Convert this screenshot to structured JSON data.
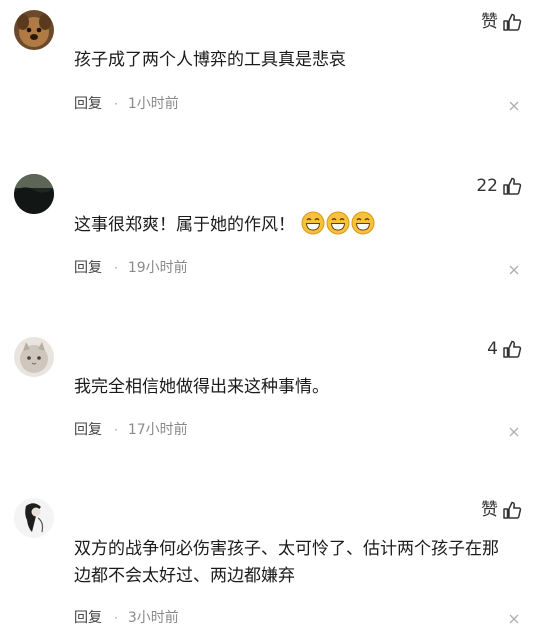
{
  "comments": [
    {
      "like_label": "赞",
      "text": "孩子成了两个人博弈的工具真是悲哀",
      "reply_label": "回复",
      "dot": "·",
      "time": "1小时前",
      "avatar_icon": "dog-avatar"
    },
    {
      "like_label": "22",
      "text": "这事很郑爽！属于她的作风！",
      "emojis": [
        "grin-emoji",
        "grin-emoji",
        "grin-emoji"
      ],
      "reply_label": "回复",
      "dot": "·",
      "time": "19小时前",
      "avatar_icon": "dark-landscape-avatar"
    },
    {
      "like_label": "4",
      "text": "我完全相信她做得出来这种事情。",
      "reply_label": "回复",
      "dot": "·",
      "time": "17小时前",
      "avatar_icon": "cat-avatar"
    },
    {
      "like_label": "赞",
      "text": "双方的战争何必伤害孩子、太可怜了、估计两个孩子在那边都不会太好过、两边都嫌弃",
      "reply_label": "回复",
      "dot": "·",
      "time": "3小时前",
      "avatar_icon": "ink-figure-avatar"
    }
  ],
  "icons": {
    "like": "thumbs-up-icon",
    "close": "close-icon"
  },
  "colors": {
    "text": "#1b1b1b",
    "meta": "#8a8a8a",
    "emoji": "#f6c23b"
  }
}
